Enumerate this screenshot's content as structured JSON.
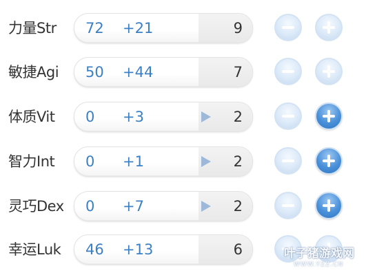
{
  "stats": [
    {
      "key": "str",
      "label": "力量Str",
      "base": "72",
      "bonus": "+21",
      "cost": "9",
      "show_arrow": false,
      "minus_enabled": false,
      "plus_enabled": false
    },
    {
      "key": "agi",
      "label": "敏捷Agi",
      "base": "50",
      "bonus": "+44",
      "cost": "7",
      "show_arrow": false,
      "minus_enabled": false,
      "plus_enabled": false
    },
    {
      "key": "vit",
      "label": "体质Vit",
      "base": "0",
      "bonus": "+3",
      "cost": "2",
      "show_arrow": true,
      "minus_enabled": false,
      "plus_enabled": true
    },
    {
      "key": "int",
      "label": "智力Int",
      "base": "0",
      "bonus": "+1",
      "cost": "2",
      "show_arrow": true,
      "minus_enabled": false,
      "plus_enabled": true
    },
    {
      "key": "dex",
      "label": "灵巧Dex",
      "base": "0",
      "bonus": "+7",
      "cost": "2",
      "show_arrow": true,
      "minus_enabled": false,
      "plus_enabled": true
    },
    {
      "key": "luk",
      "label": "幸运Luk",
      "base": "46",
      "bonus": "+13",
      "cost": "6",
      "show_arrow": false,
      "minus_enabled": false,
      "plus_enabled": false
    }
  ],
  "icons": {
    "minus": "minus-icon",
    "plus": "plus-icon",
    "arrow": "play-arrow-icon"
  },
  "colors": {
    "value_blue": "#3b7fc4",
    "button_active": "#4a90d9",
    "button_disabled": "#dbe9f8"
  },
  "watermark": {
    "main": "叶子猪游戏网",
    "sub": "WWW.YZZ.CN"
  }
}
